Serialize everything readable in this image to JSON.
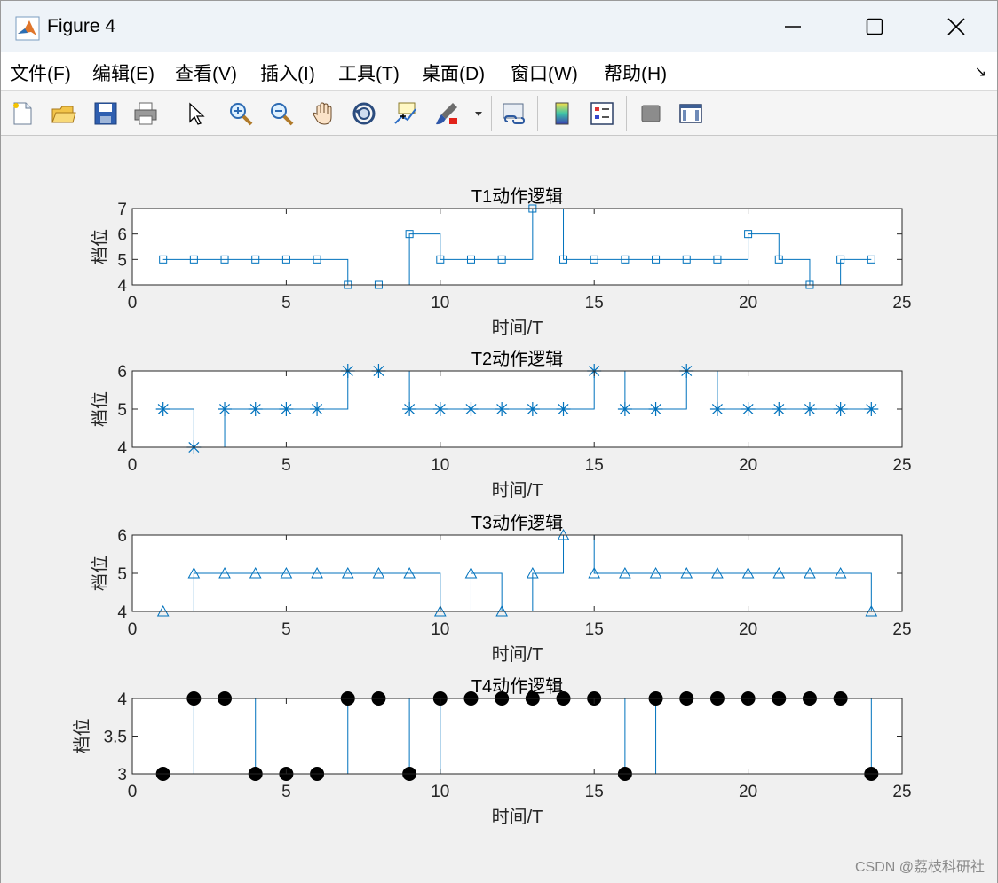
{
  "window": {
    "title": "Figure 4",
    "minimize_icon": "minimize-icon",
    "maximize_icon": "maximize-icon",
    "close_icon": "close-icon"
  },
  "menu": {
    "items": [
      "文件(F)",
      "编辑(E)",
      "查看(V)",
      "插入(I)",
      "工具(T)",
      "桌面(D)",
      "窗口(W)",
      "帮助(H)"
    ]
  },
  "toolbar": {
    "buttons": [
      "new-figure-icon",
      "open-file-icon",
      "save-icon",
      "print-icon",
      "edit-pointer-icon",
      "zoom-in-icon",
      "zoom-out-icon",
      "pan-hand-icon",
      "rotate-3d-icon",
      "data-cursor-icon",
      "brush-icon",
      "link-plot-icon",
      "colorbar-icon",
      "legend-icon",
      "hide-plot-tools-icon",
      "show-plot-tools-icon"
    ]
  },
  "watermark": "CSDN @荔枝科研社",
  "colors": {
    "line": "#0072bd",
    "marker_fill": "#000000"
  },
  "chart_data": [
    {
      "type": "line",
      "title": "T1动作逻辑",
      "xlabel": "时间/T",
      "ylabel": "档位",
      "x": [
        1,
        2,
        3,
        4,
        5,
        6,
        7,
        8,
        9,
        10,
        11,
        12,
        13,
        14,
        15,
        16,
        17,
        18,
        19,
        20,
        21,
        22,
        23,
        24
      ],
      "series": [
        {
          "values": [
            5,
            5,
            5,
            5,
            5,
            5,
            4,
            4,
            6,
            5,
            5,
            5,
            7,
            5,
            5,
            5,
            5,
            5,
            5,
            6,
            5,
            4,
            5,
            5
          ],
          "marker": "square",
          "step": true
        }
      ],
      "xlim": [
        0,
        25
      ],
      "ylim": [
        4,
        7
      ],
      "xticks": [
        "0",
        "5",
        "10",
        "15",
        "20",
        "25"
      ],
      "yticks": [
        "4",
        "5",
        "6",
        "7"
      ]
    },
    {
      "type": "line",
      "title": "T2动作逻辑",
      "xlabel": "时间/T",
      "ylabel": "档位",
      "x": [
        1,
        2,
        3,
        4,
        5,
        6,
        7,
        8,
        9,
        10,
        11,
        12,
        13,
        14,
        15,
        16,
        17,
        18,
        19,
        20,
        21,
        22,
        23,
        24
      ],
      "series": [
        {
          "values": [
            5,
            4,
            5,
            5,
            5,
            5,
            6,
            6,
            5,
            5,
            5,
            5,
            5,
            5,
            6,
            5,
            5,
            6,
            5,
            5,
            5,
            5,
            5,
            5
          ],
          "marker": "asterisk",
          "step": true
        }
      ],
      "xlim": [
        0,
        25
      ],
      "ylim": [
        4,
        6
      ],
      "xticks": [
        "0",
        "5",
        "10",
        "15",
        "20",
        "25"
      ],
      "yticks": [
        "4",
        "5",
        "6"
      ]
    },
    {
      "type": "line",
      "title": "T3动作逻辑",
      "xlabel": "时间/T",
      "ylabel": "档位",
      "x": [
        1,
        2,
        3,
        4,
        5,
        6,
        7,
        8,
        9,
        10,
        11,
        12,
        13,
        14,
        15,
        16,
        17,
        18,
        19,
        20,
        21,
        22,
        23,
        24
      ],
      "series": [
        {
          "values": [
            4,
            5,
            5,
            5,
            5,
            5,
            5,
            5,
            5,
            4,
            5,
            4,
            5,
            6,
            5,
            5,
            5,
            5,
            5,
            5,
            5,
            5,
            5,
            4
          ],
          "marker": "triangle",
          "step": true
        }
      ],
      "xlim": [
        0,
        25
      ],
      "ylim": [
        4,
        6
      ],
      "xticks": [
        "0",
        "5",
        "10",
        "15",
        "20",
        "25"
      ],
      "yticks": [
        "4",
        "5",
        "6"
      ]
    },
    {
      "type": "line",
      "title": "T4动作逻辑",
      "xlabel": "时间/T",
      "ylabel": "档位",
      "x": [
        1,
        2,
        3,
        4,
        5,
        6,
        7,
        8,
        9,
        10,
        11,
        12,
        13,
        14,
        15,
        16,
        17,
        18,
        19,
        20,
        21,
        22,
        23,
        24
      ],
      "series": [
        {
          "values": [
            3,
            4,
            4,
            3,
            3,
            3,
            4,
            4,
            3,
            4,
            4,
            4,
            4,
            4,
            4,
            3,
            4,
            4,
            4,
            4,
            4,
            4,
            4,
            3
          ],
          "marker": "filled-circle",
          "step": true
        }
      ],
      "xlim": [
        0,
        25
      ],
      "ylim": [
        3,
        4
      ],
      "xticks": [
        "0",
        "5",
        "10",
        "15",
        "20",
        "25"
      ],
      "yticks": [
        "3",
        "3.5",
        "4"
      ]
    }
  ]
}
